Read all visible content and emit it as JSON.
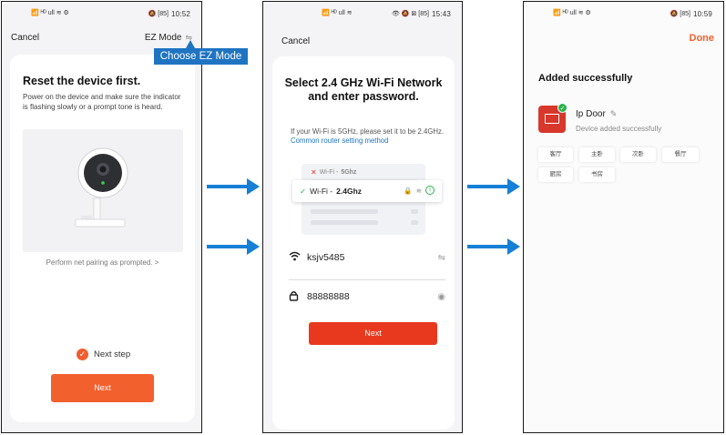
{
  "screen1": {
    "status": {
      "left": "📶 ᴴᴰ ull ≋ ⚙",
      "right": "🔕 [85]",
      "time": "10:52"
    },
    "cancel_label": "Cancel",
    "ez_mode_label": "EZ Mode",
    "tooltip": "Choose EZ Mode",
    "title": "Reset the device first.",
    "description": "Power on the device and make sure the indicator is flashing slowly or a prompt tone is heard.",
    "hint": "Perform net pairing as prompted.",
    "next_step_label": "Next step",
    "next_step_checked": true,
    "next_button": "Next"
  },
  "screen2": {
    "status": {
      "left": "📶 ᴴᴰ ull ≋",
      "right": "👁 🔕 ⊠ [85]",
      "time": "15:43"
    },
    "cancel_label": "Cancel",
    "title": "Select 2.4 GHz Wi-Fi Network and enter password.",
    "description_prefix": "If your Wi-Fi is 5GHz, please set it to be 2.4GHz. ",
    "description_link": "Common router setting method",
    "wifi_bad_prefix": "Wi-Fi - ",
    "wifi_bad_band": "5Ghz",
    "wifi_good_prefix": "Wi-Fi - ",
    "wifi_good_band": "2.4Ghz",
    "ssid_value": "ksjv5485",
    "password_value": "88888888",
    "next_button": "Next"
  },
  "screen3": {
    "status": {
      "left": "📶 ᴴᴰ ull ≋ ⚙",
      "right": "🔕 [85]",
      "time": "10:59"
    },
    "done_label": "Done",
    "added_title": "Added successfully",
    "device_name": "Ip Door",
    "device_status": "Device added successfully",
    "rooms": [
      "客厅",
      "主卧",
      "次卧",
      "餐厅",
      "厨房",
      "书房"
    ]
  },
  "colors": {
    "accent": "#f2602e",
    "next_red": "#e8391f",
    "tooltip_blue": "#1f74c2",
    "arrow_blue": "#1580d6",
    "success_green": "#2bb24c"
  }
}
